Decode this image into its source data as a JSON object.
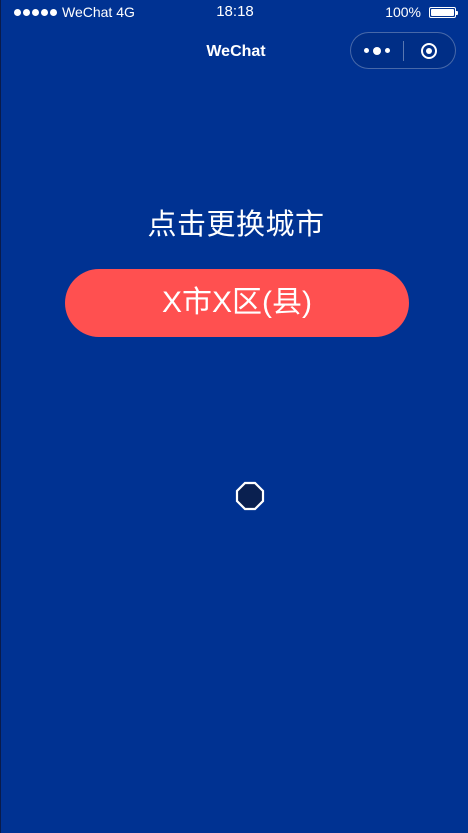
{
  "status_bar": {
    "carrier": "WeChat 4G",
    "time": "18:18",
    "battery": "100%",
    "battery_level": 1.0,
    "signal_bars": 5
  },
  "nav": {
    "title": "WeChat",
    "more_icon": "more-dots-icon",
    "close_icon": "target-close-icon"
  },
  "main": {
    "prompt": "点击更换城市",
    "city_button_label": "X市X区(县)",
    "loader_icon": "octagon-loader-icon"
  },
  "colors": {
    "background": "#003292",
    "button": "#ff5050",
    "text": "#ffffff",
    "loader_fill": "#0a2050"
  }
}
